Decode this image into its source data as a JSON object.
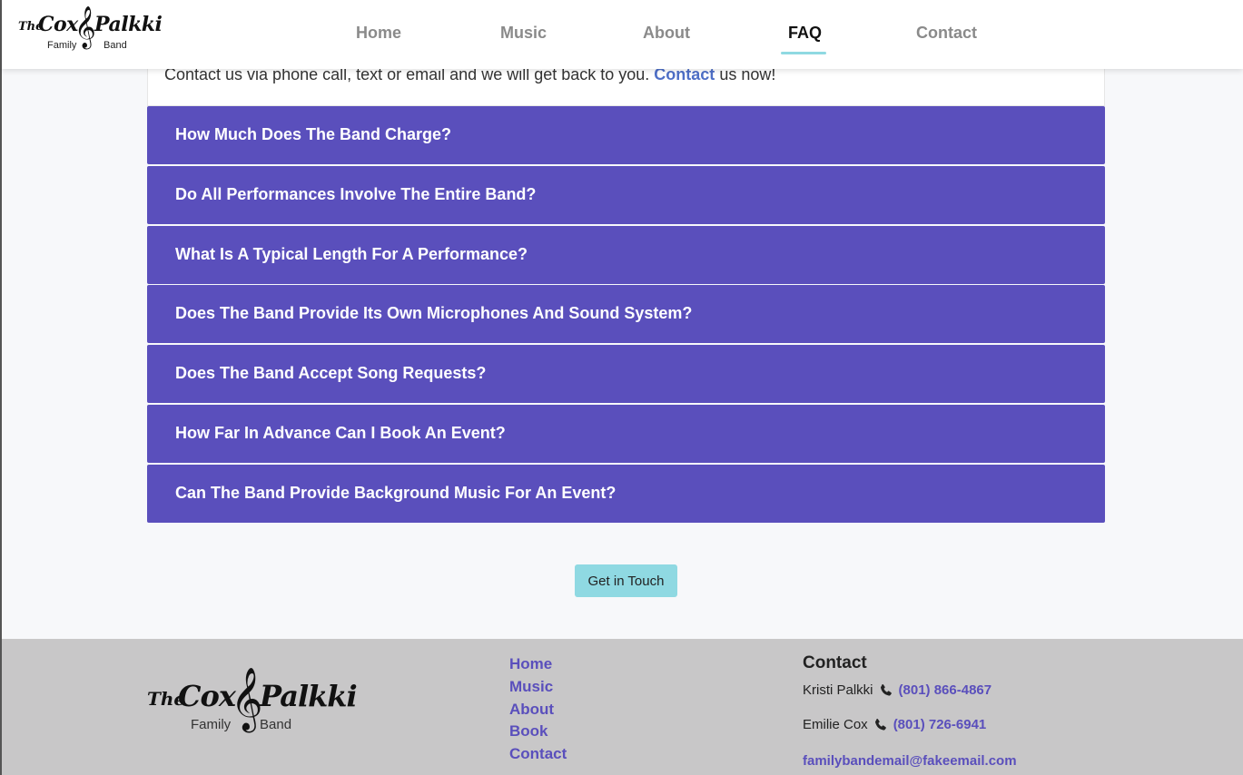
{
  "header": {
    "logo": {
      "the": "The",
      "cox": "Cox",
      "palkki": "Palkki",
      "family": "Family",
      "band": "Band"
    },
    "nav": [
      {
        "label": "Home"
      },
      {
        "label": "Music"
      },
      {
        "label": "About"
      },
      {
        "label": "FAQ",
        "active": true
      },
      {
        "label": "Contact"
      }
    ]
  },
  "intro": {
    "before": "Contact us via phone call, text or email and we will get back to you.",
    "link": "Contact",
    "after": "us now!"
  },
  "faq": [
    "How Much Does The Band Charge?",
    "Do All Performances Involve The Entire Band?",
    "What Is A Typical Length For A Performance?",
    "Does The Band Provide Its Own Microphones And Sound System?",
    "Does The Band Accept Song Requests?",
    "How Far In Advance Can I Book An Event?",
    "Can The Band Provide Background Music For An Event?"
  ],
  "cta": {
    "label": "Get in Touch"
  },
  "footer": {
    "logo": {
      "the": "The",
      "cox": "Cox",
      "palkki": "Palkki",
      "family": "Family",
      "band": "Band"
    },
    "links": [
      "Home",
      "Music",
      "About",
      "Book",
      "Contact"
    ],
    "contact": {
      "heading": "Contact",
      "people": [
        {
          "name": "Kristi Palkki",
          "phone": "(801) 866-4867"
        },
        {
          "name": "Emilie Cox",
          "phone": "(801) 726-6941"
        }
      ],
      "email": "familybandemail@fakeemail.com"
    }
  },
  "colors": {
    "accent": "#5a4fbc",
    "cta": "#8fd9e2",
    "footer_bg": "#c8c7c8"
  },
  "icons": {
    "phone": "phone-icon",
    "treble_clef": "treble-clef-icon"
  }
}
